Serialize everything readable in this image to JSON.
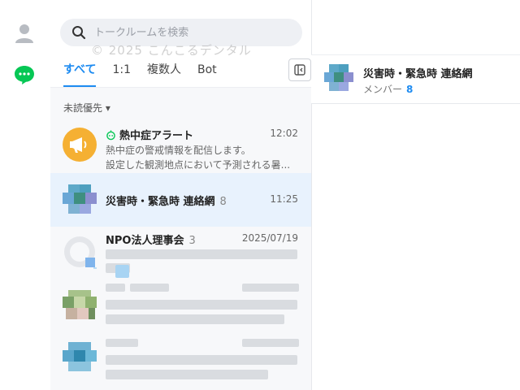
{
  "rail": {
    "profile_icon": "person-icon",
    "chats_icon": "chat-bubble-icon",
    "accent": "#06c755"
  },
  "search": {
    "placeholder": "トークルームを検索",
    "icon": "search-icon"
  },
  "watermark": "© 2025 こんこるデンタル",
  "tabs": [
    {
      "label": "すべて",
      "active": true
    },
    {
      "label": "1:1",
      "active": false
    },
    {
      "label": "複数人",
      "active": false
    },
    {
      "label": "Bot",
      "active": false
    }
  ],
  "sort_label": "未読優先 ▾",
  "rooms": [
    {
      "name": "熱中症アラート",
      "bot": true,
      "time": "12:02",
      "preview1": "熱中症の警戒情報を配信します。",
      "preview2": "設定した観測地点において予測される暑..."
    },
    {
      "name": "災害時・緊急時 連絡網",
      "count": "8",
      "time": "11:25",
      "selected": true
    },
    {
      "name": "NPO法人理事会",
      "count": "3",
      "time": "2025/07/19"
    }
  ],
  "chat": {
    "title": "災害時・緊急時 連絡網",
    "members_label": "メンバー",
    "members_count": "8"
  },
  "colors": {
    "accent_blue": "#1d8bf1",
    "selected_row": "#e8f2fd",
    "alert_orange": "#f5b033"
  }
}
